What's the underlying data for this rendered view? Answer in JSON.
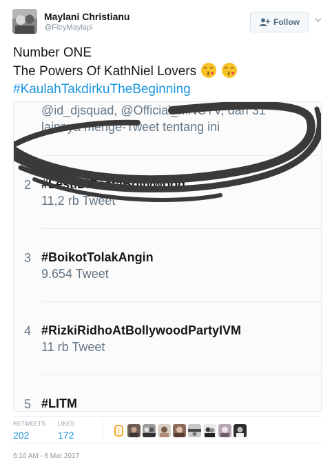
{
  "author": {
    "name": "Maylani Christianu",
    "handle": "@FitryMaylapi",
    "avatar_icon": "user-avatar"
  },
  "follow_button": {
    "label": "Follow",
    "icon": "follow-user-icon"
  },
  "tweet": {
    "line1": "Number ONE",
    "line2": "The Powers Of KathNiel Lovers",
    "hashtag": "#KaulahTakdirkuTheBeginning",
    "emojis": [
      "kissing-face-emoji",
      "kissing-face-emoji"
    ]
  },
  "screenshot": {
    "header_line1": "@id_djsquad, @Official_MNCTV, dan 31",
    "header_line2": "lainnya menge-Tweet tentang ini",
    "trends": [
      {
        "rank": "2",
        "tag": "#LestiDiPestaBollywood",
        "count": "11,2 rb Tweet"
      },
      {
        "rank": "3",
        "tag": "#BoikotTolakAngin",
        "count": "9.654 Tweet"
      },
      {
        "rank": "4",
        "tag": "#RizkiRidhoAtBollywoodPartyIVM",
        "count": "11 rb Tweet"
      },
      {
        "rank": "5",
        "tag": "#LITM",
        "count": ""
      }
    ]
  },
  "stats": {
    "retweets_label": "RETWEETS",
    "retweets_value": "202",
    "likes_label": "LIKES",
    "likes_value": "172"
  },
  "timestamp": "6:10 AM - 6 Mar 2017",
  "colors": {
    "link": "#1b95e0",
    "muted": "#8899a6",
    "border": "#e1e8ed",
    "scribble": "#3a3a3a"
  }
}
